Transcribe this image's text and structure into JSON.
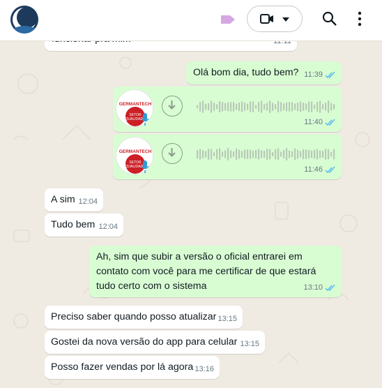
{
  "header": {
    "video_icon": "video-camera-icon",
    "dropdown_icon": "chevron-down-icon",
    "search_icon": "search-icon",
    "menu_icon": "menu-icon",
    "label_icon": "label-tag-icon",
    "label_color": "#d5a8e4"
  },
  "colors": {
    "incoming": "#ffffff",
    "outgoing": "#d9fdd3",
    "tick": "#53bdeb",
    "background": "#efeae2"
  },
  "messages": [
    {
      "dir": "in",
      "text": "funcionar pra mim",
      "time": "11:11"
    },
    {
      "dir": "out",
      "text": "Olá bom dia, tudo bem?",
      "time": "11:39"
    },
    {
      "dir": "out",
      "type": "voice",
      "brand": "GERMANTECH",
      "brand_sub": "SETOR QUALIDADE",
      "time": "11:40"
    },
    {
      "dir": "out",
      "type": "voice",
      "brand": "GERMANTECH",
      "brand_sub": "SETOR QUALIDADE",
      "time": "11:46"
    },
    {
      "dir": "in",
      "text": "A sim",
      "time": "12:04"
    },
    {
      "dir": "in",
      "text": "Tudo bem",
      "time": "12:04"
    },
    {
      "dir": "out",
      "text_lines": [
        "Ah, sim que subir a versão o oficial entrarei em",
        "contato com você para me certificar de que estará",
        "tudo certo com o sistema"
      ],
      "time": "13:10"
    },
    {
      "dir": "in",
      "text": "Preciso saber quando posso atualizar",
      "time": "13:15"
    },
    {
      "dir": "in",
      "text": "Gostei da nova versão do app para celular",
      "time": "13:15"
    },
    {
      "dir": "in",
      "text": "Posso fazer vendas por lá agora",
      "time": "13:16"
    }
  ]
}
